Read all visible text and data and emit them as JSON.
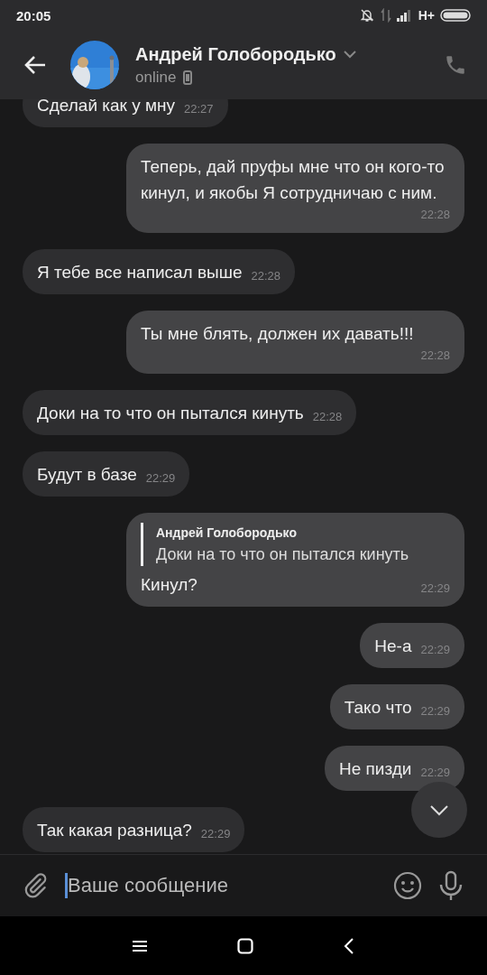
{
  "status_bar": {
    "time": "20:05",
    "network": "H+"
  },
  "header": {
    "name": "Андрей Голобородько",
    "status": "online"
  },
  "messages": [
    {
      "outgoing": false,
      "text": "Сделай как у мну",
      "time": "22:27"
    },
    {
      "outgoing": true,
      "text": "Теперь, дай пруфы мне что он кого-то кинул, и якобы Я сотрудничаю с ним.",
      "time": "22:28"
    },
    {
      "outgoing": false,
      "text": "Я тебе все написал выше",
      "time": "22:28"
    },
    {
      "outgoing": true,
      "text": "Ты мне блять, должен их давать!!!",
      "time": "22:28"
    },
    {
      "outgoing": false,
      "text": "Доки на то что он пытался кинуть",
      "time": "22:28"
    },
    {
      "outgoing": false,
      "text": "Будут в базе",
      "time": "22:29"
    },
    {
      "outgoing": true,
      "reply": {
        "author": "Андрей Голобородько",
        "text": "Доки на то что он пытался кинуть"
      },
      "text": "Кинул?",
      "time": "22:29"
    },
    {
      "outgoing": true,
      "text": "Не-а",
      "time": "22:29"
    },
    {
      "outgoing": true,
      "text": "Тако что",
      "time": "22:29"
    },
    {
      "outgoing": true,
      "text": "Не пизди",
      "time": "22:29"
    },
    {
      "outgoing": false,
      "text": "Так какая разница?",
      "time": "22:29"
    }
  ],
  "composer": {
    "placeholder": "Ваше сообщение"
  }
}
